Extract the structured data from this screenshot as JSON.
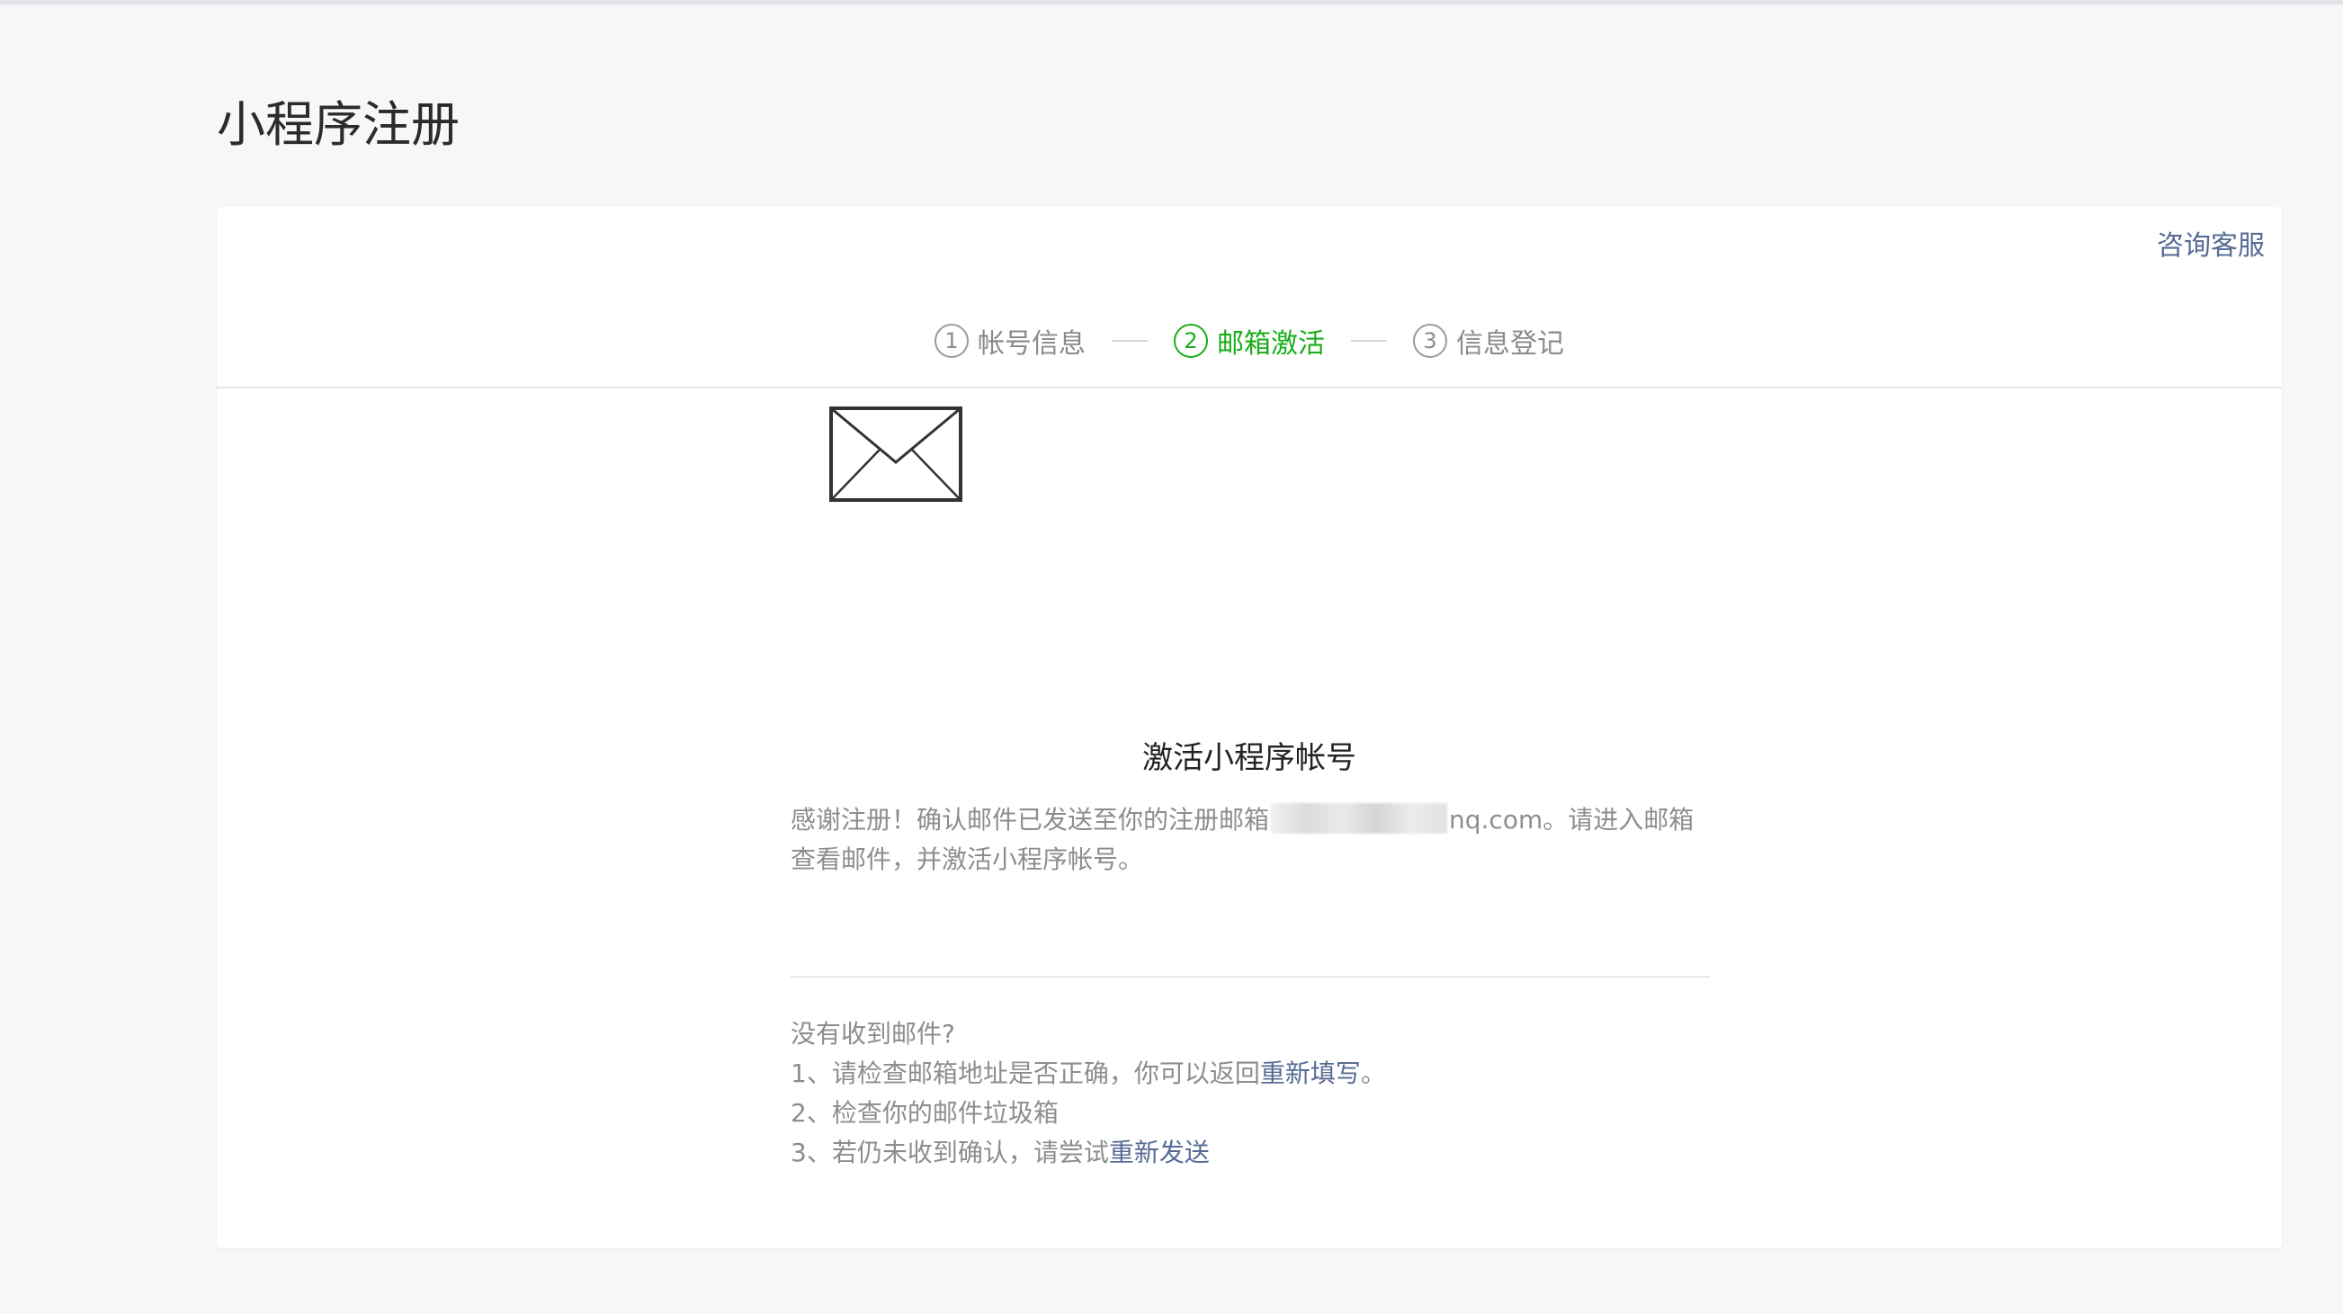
{
  "page": {
    "title": "小程序注册"
  },
  "header": {
    "consult_label": "咨询客服"
  },
  "steps": [
    {
      "num": "1",
      "label": "帐号信息",
      "active": false
    },
    {
      "num": "2",
      "label": "邮箱激活",
      "active": true
    },
    {
      "num": "3",
      "label": "信息登记",
      "active": false
    }
  ],
  "activation": {
    "icon": "envelope-icon",
    "title": "激活小程序帐号",
    "desc_prefix": "感谢注册！确认邮件已发送至你的注册邮箱",
    "desc_email_suffix": "nq.com",
    "desc_suffix": "。请进入邮箱查看邮件，并激活小程序帐号。"
  },
  "help": {
    "heading": "没有收到邮件?",
    "line1_prefix": "1、请检查邮箱地址是否正确，你可以返回",
    "line1_link": "重新填写",
    "line1_suffix": "。",
    "line2": "2、检查你的邮件垃圾箱",
    "line3_prefix": "3、若仍未收到确认，请尝试",
    "line3_link": "重新发送"
  },
  "colors": {
    "accent_green": "#1aad19",
    "link_blue": "#576b95"
  }
}
